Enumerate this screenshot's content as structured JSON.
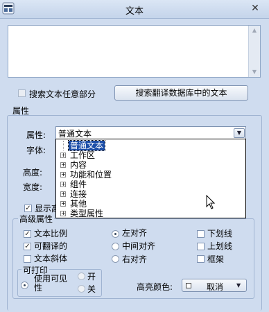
{
  "window": {
    "title": "文本",
    "close_glyph": "✕"
  },
  "search": {
    "partial_label": "搜索文本任意部分",
    "partial_checked": false,
    "db_button": "搜索翻译数据库中的文本"
  },
  "properties": {
    "group_title": "属性",
    "attribute_label": "属性:",
    "attribute_value": "普通文本",
    "font_label": "字体:",
    "height_label": "高度:",
    "width_label": "宽度:",
    "show_label": "显示高",
    "show_checked": true
  },
  "dropdown": {
    "items": [
      {
        "label": "普通文本",
        "expandable": false,
        "selected": true
      },
      {
        "label": "工作区",
        "expandable": true
      },
      {
        "label": "内容",
        "expandable": true
      },
      {
        "label": "功能和位置",
        "expandable": true
      },
      {
        "label": "组件",
        "expandable": true
      },
      {
        "label": "连接",
        "expandable": true
      },
      {
        "label": "其他",
        "expandable": true
      },
      {
        "label": "类型属性",
        "expandable": true
      }
    ]
  },
  "advanced": {
    "group_title": "高级属性",
    "text_scale": {
      "label": "文本比例",
      "checked": true
    },
    "translatable": {
      "label": "可翻译的",
      "checked": true
    },
    "italic": {
      "label": "文本斜体",
      "checked": false
    },
    "align_left": {
      "label": "左对齐",
      "selected": true
    },
    "align_center": {
      "label": "中间对齐",
      "selected": false
    },
    "align_right": {
      "label": "右对齐",
      "selected": false
    },
    "underline": {
      "label": "下划线",
      "checked": false
    },
    "overline": {
      "label": "上划线",
      "checked": false
    },
    "frame": {
      "label": "框架",
      "checked": false
    }
  },
  "printable": {
    "group_title": "可打印",
    "use_visible": "使用可见性",
    "on": "开",
    "off": "关"
  },
  "highlight": {
    "label": "高亮颜色:",
    "value": "取消"
  }
}
